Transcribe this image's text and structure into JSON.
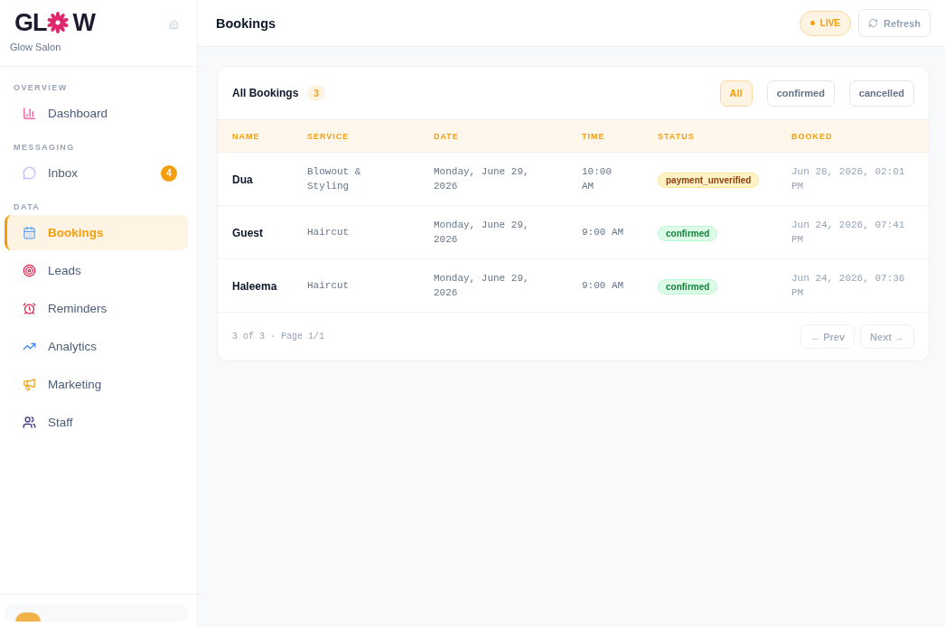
{
  "brand": {
    "logo_left": "GL",
    "logo_right": "W",
    "name": "Glow Salon"
  },
  "sidebar": {
    "sections": [
      {
        "title": "OVERVIEW",
        "items": [
          {
            "label": "Dashboard",
            "selected": false
          }
        ]
      },
      {
        "title": "MESSAGING",
        "items": [
          {
            "label": "Inbox",
            "selected": false,
            "badge": "4"
          }
        ]
      },
      {
        "title": "DATA",
        "items": [
          {
            "label": "Bookings",
            "selected": true
          },
          {
            "label": "Leads",
            "selected": false
          },
          {
            "label": "Reminders",
            "selected": false
          },
          {
            "label": "Analytics",
            "selected": false
          },
          {
            "label": "Marketing",
            "selected": false
          },
          {
            "label": "Staff",
            "selected": false
          }
        ]
      }
    ]
  },
  "header": {
    "title": "Bookings",
    "live": "LIVE",
    "refresh": "Refresh"
  },
  "card": {
    "title": "All Bookings",
    "count": "3",
    "filters": [
      {
        "label": "All",
        "selected": true
      },
      {
        "label": "confirmed",
        "selected": false
      },
      {
        "label": "cancelled",
        "selected": false
      }
    ],
    "table": {
      "columns": [
        "NAME",
        "SERVICE",
        "DATE",
        "TIME",
        "STATUS",
        "BOOKED"
      ],
      "rows": [
        {
          "name": "Dua",
          "service": "Blowout & Styling",
          "date": "Monday, June 29, 2026",
          "time": "10:00 AM",
          "status": "payment_unverified",
          "kind": "warning",
          "booked": "Jun 28, 2026, 02:01 PM"
        },
        {
          "name": "Guest",
          "service": "Haircut",
          "date": "Monday, June 29, 2026",
          "time": "9:00 AM",
          "status": "confirmed",
          "kind": "success",
          "booked": "Jun 24, 2026, 07:41 PM"
        },
        {
          "name": "Haleema",
          "service": "Haircut",
          "date": "Monday, June 29, 2026",
          "time": "9:00 AM",
          "status": "confirmed",
          "kind": "success",
          "booked": "Jun 24, 2026, 07:36 PM"
        }
      ]
    },
    "pagination": {
      "summary": "3 of 3 · Page 1/1",
      "prev": "← Prev",
      "next": "Next →",
      "prev_disabled": true,
      "next_disabled": true
    }
  }
}
